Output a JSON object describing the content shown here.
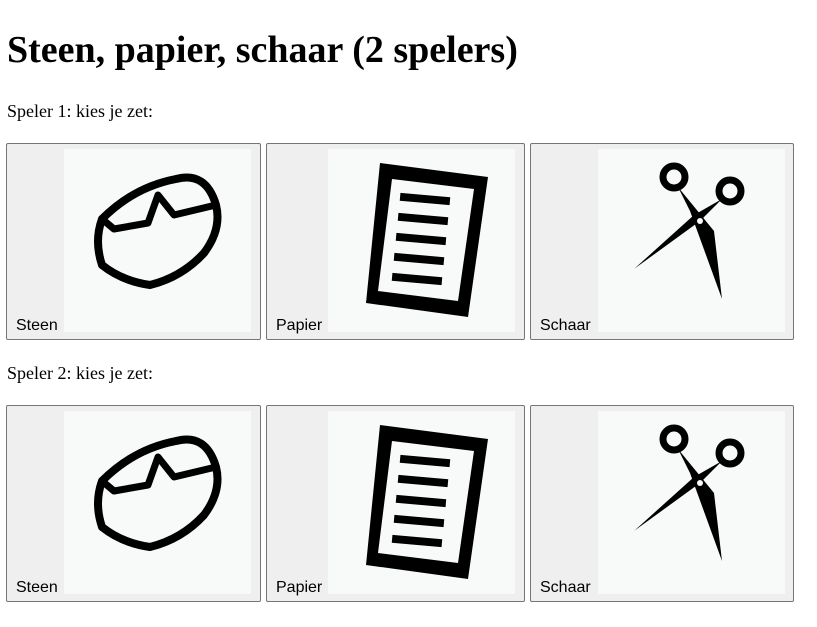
{
  "page": {
    "title": "Steen, papier, schaar (2 spelers)"
  },
  "players": [
    {
      "prompt": "Speler 1: kies je zet:",
      "moves": [
        {
          "label": "Steen",
          "icon": "rock-icon"
        },
        {
          "label": "Papier",
          "icon": "paper-icon"
        },
        {
          "label": "Schaar",
          "icon": "scissors-icon"
        }
      ]
    },
    {
      "prompt": "Speler 2: kies je zet:",
      "moves": [
        {
          "label": "Steen",
          "icon": "rock-icon"
        },
        {
          "label": "Papier",
          "icon": "paper-icon"
        },
        {
          "label": "Schaar",
          "icon": "scissors-icon"
        }
      ]
    }
  ],
  "colors": {
    "button_bg": "#efefef",
    "button_border": "#767676",
    "image_bg": "#f8f9f9",
    "icon_ink": "#000000"
  }
}
